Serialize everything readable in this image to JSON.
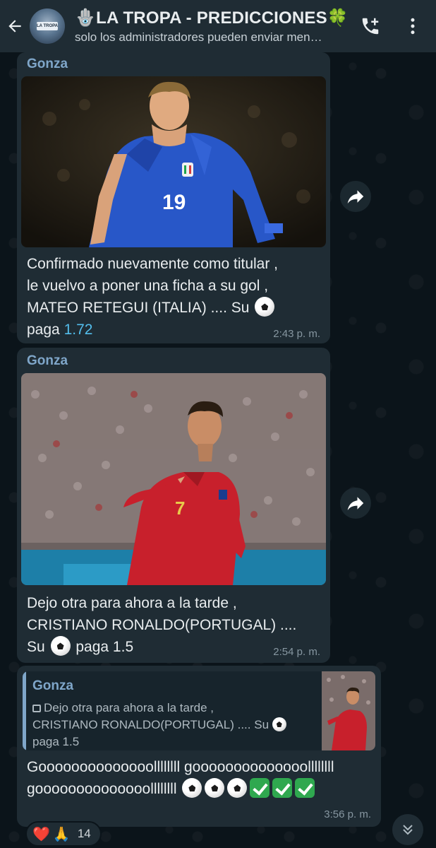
{
  "header": {
    "title": "🪬LA TROPA - PREDICCIONES🍀",
    "subtitle": "solo los administradores pueden enviar men…",
    "avatar_label": "LA TROPA"
  },
  "messages": [
    {
      "sender": "Gonza",
      "photo_alt": "Jugador de Italia número 19",
      "text_lines": [
        "Confirmado nuevamente como titular ,",
        "le vuelvo a poner una ficha a su gol ,",
        "MATEO RETEGUI (ITALIA) .... Su"
      ],
      "pay_label": "paga",
      "odds": "1.72",
      "time": "2:43 p. m."
    },
    {
      "sender": "Gonza",
      "photo_alt": "Jugador de Portugal número 7",
      "text_lines": [
        "Dejo otra para ahora a la tarde ,",
        "CRISTIANO RONALDO(PORTUGAL) ....",
        "Su"
      ],
      "pay_text": "paga 1.5",
      "time": "2:54 p. m."
    },
    {
      "reply": {
        "sender": "Gonza",
        "line1": "Dejo otra para ahora a la tarde ,",
        "line2": "CRISTIANO RONALDO(PORTUGAL) .... Su",
        "line3": "paga 1.5"
      },
      "line1": "Goooooooooooooollllllll goooooooooooooollllllll",
      "line2": "goooooooooooooollllllll",
      "time": "3:56 p. m."
    }
  ],
  "reactions": {
    "emoji1": "❤️",
    "emoji2": "🙏",
    "count": "14"
  },
  "colors": {
    "accent": "#7fa6c9",
    "bubble": "#1f2c34",
    "background": "#0b141a",
    "link": "#53bdeb"
  }
}
